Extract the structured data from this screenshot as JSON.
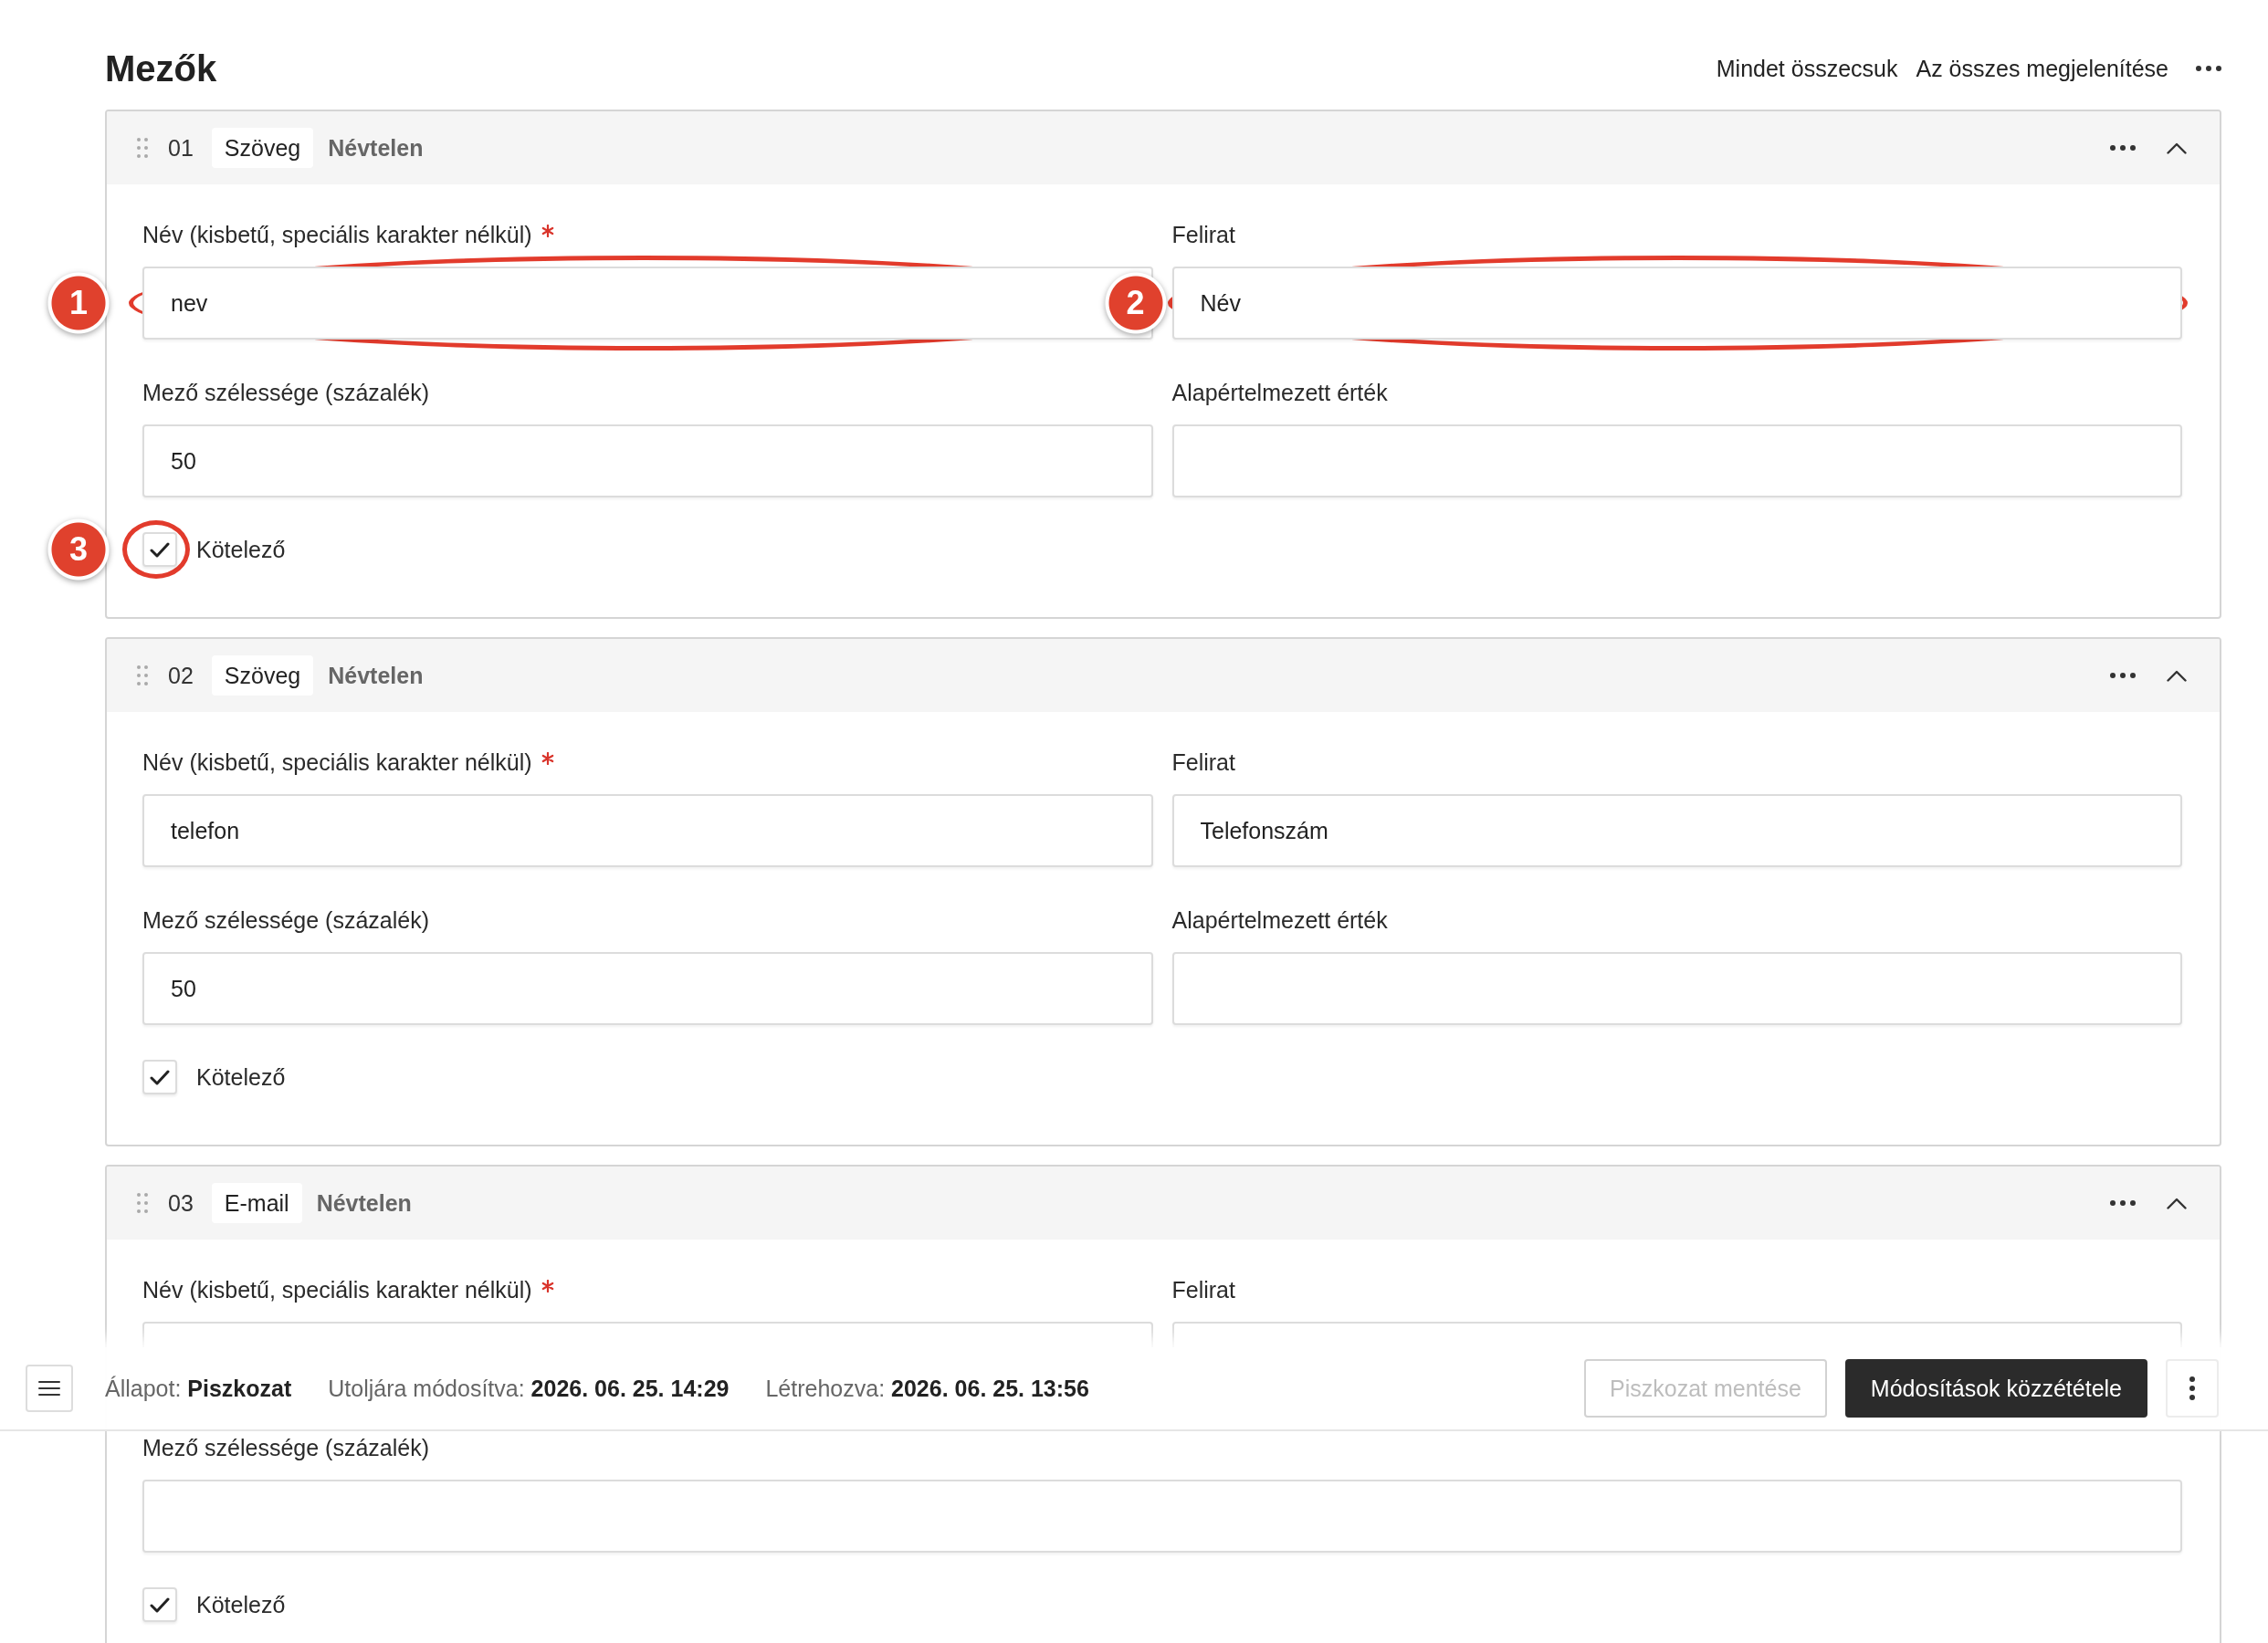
{
  "header": {
    "title": "Mezők",
    "actions": [
      {
        "label": "Mindet összecsuk"
      },
      {
        "label": "Az összes megjelenítése"
      }
    ]
  },
  "fields": [
    {
      "number": "01",
      "type": "Szöveg",
      "name": "Névtelen",
      "expanded": true,
      "inputs": [
        {
          "label": "Név (kisbetű, speciális karakter nélkül)",
          "required": true,
          "wide": false,
          "value": "nev",
          "annotation": "1"
        },
        {
          "label": "Felirat",
          "required": false,
          "wide": false,
          "value": "Név",
          "annotation": "2"
        },
        {
          "label": "Mező szélessége (százalék)",
          "required": false,
          "wide": false,
          "value": "50"
        },
        {
          "label": "Alapértelmezett érték",
          "required": false,
          "wide": false
        }
      ],
      "checkbox": {
        "label": "Kötelező",
        "checked": true,
        "annotation": "3"
      }
    },
    {
      "number": "02",
      "type": "Szöveg",
      "name": "Névtelen",
      "expanded": true,
      "inputs": [
        {
          "label": "Név (kisbetű, speciális karakter nélkül)",
          "required": true,
          "wide": false,
          "value": "telefon"
        },
        {
          "label": "Felirat",
          "required": false,
          "wide": false,
          "value": "Telefonszám"
        },
        {
          "label": "Mező szélessége (százalék)",
          "required": false,
          "wide": false,
          "value": "50"
        },
        {
          "label": "Alapértelmezett érték",
          "required": false,
          "wide": false
        }
      ],
      "checkbox": {
        "label": "Kötelező",
        "checked": true
      }
    },
    {
      "number": "03",
      "type": "E-mail",
      "name": "Névtelen",
      "expanded": true,
      "inputs": [
        {
          "label": "Név (kisbetű, speciális karakter nélkül)",
          "required": true,
          "wide": false
        },
        {
          "label": "Felirat",
          "required": false,
          "wide": false
        },
        {
          "label": "Mező szélessége (százalék)",
          "required": false,
          "wide": true
        }
      ],
      "checkbox": {
        "label": "Kötelező",
        "checked": true
      }
    }
  ],
  "status_bar": {
    "meta": [
      "Állapot: **Piszkozat**",
      "Utoljára módosítva: **2026. 06. 25. 14:29**",
      "Létrehozva: **2026. 06. 25. 13:56**"
    ],
    "buttons": [
      {
        "label": "Piszkozat mentése",
        "kind": "secondary",
        "disabled": true
      },
      {
        "label": "Módosítások közzététele",
        "kind": "primary",
        "disabled": false
      }
    ]
  }
}
